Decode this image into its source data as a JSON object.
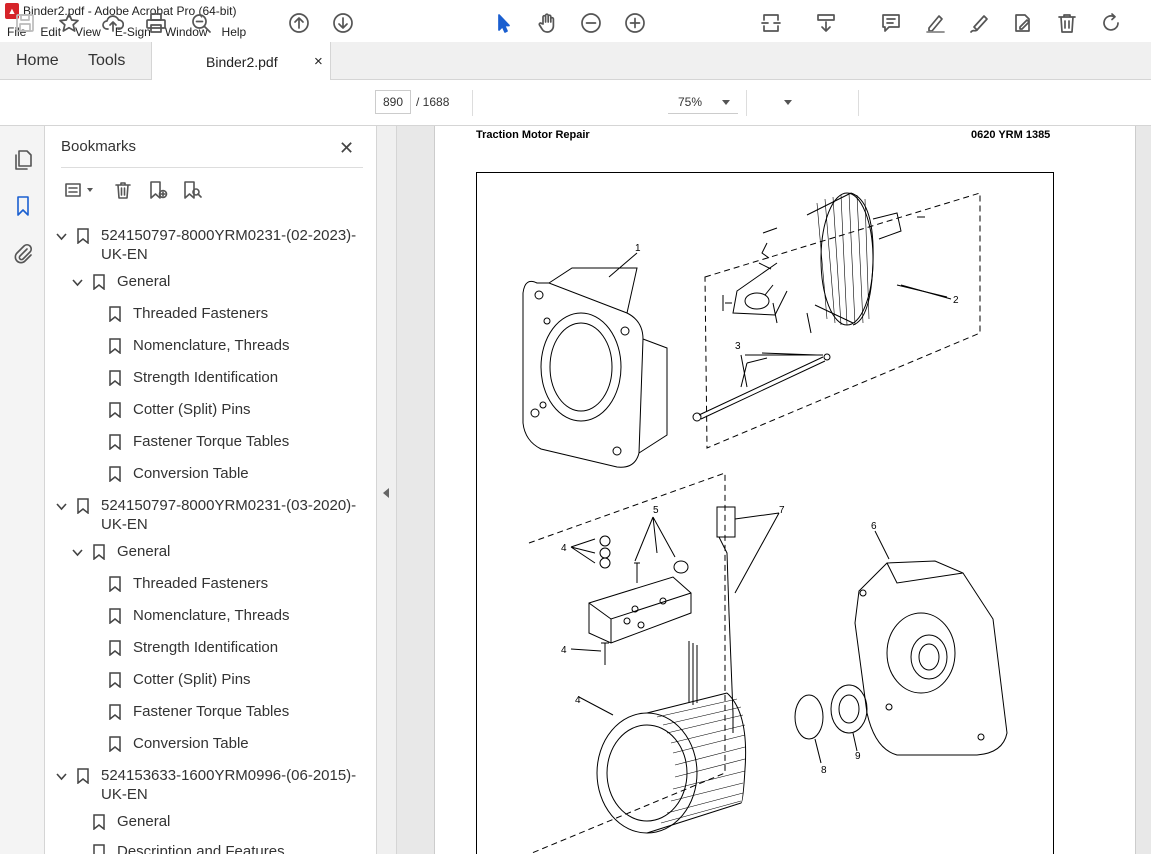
{
  "window": {
    "title": "Binder2.pdf - Adobe Acrobat Pro (64-bit)"
  },
  "menu": [
    "File",
    "Edit",
    "View",
    "E-Sign",
    "Window",
    "Help"
  ],
  "tabs": {
    "home": "Home",
    "tools": "Tools",
    "document": "Binder2.pdf",
    "close": "×"
  },
  "toolbar": {
    "current_page": "890",
    "page_total": "/  1688",
    "zoom": "75%"
  },
  "sidebar": {
    "title": "Bookmarks",
    "close": "✕",
    "items": [
      {
        "label": "524150797-8000YRM0231-(02-2023)-",
        "label2": "UK-EN",
        "level": 0,
        "expanded": true
      },
      {
        "label": "General",
        "level": 1,
        "expanded": true
      },
      {
        "label": "Threaded Fasteners",
        "level": 2
      },
      {
        "label": "Nomenclature, Threads",
        "level": 2
      },
      {
        "label": "Strength Identification",
        "level": 2
      },
      {
        "label": "Cotter (Split) Pins",
        "level": 2
      },
      {
        "label": "Fastener Torque Tables",
        "level": 2
      },
      {
        "label": "Conversion Table",
        "level": 2
      },
      {
        "label": "524150797-8000YRM0231-(03-2020)-",
        "label2": "UK-EN",
        "level": 0,
        "expanded": true
      },
      {
        "label": "General",
        "level": 1,
        "expanded": true
      },
      {
        "label": "Threaded Fasteners",
        "level": 2
      },
      {
        "label": "Nomenclature, Threads",
        "level": 2
      },
      {
        "label": "Strength Identification",
        "level": 2
      },
      {
        "label": "Cotter (Split) Pins",
        "level": 2
      },
      {
        "label": "Fastener Torque Tables",
        "level": 2
      },
      {
        "label": "Conversion Table",
        "level": 2
      },
      {
        "label": "524153633-1600YRM0996-(06-2015)-",
        "label2": "UK-EN",
        "level": 0,
        "expanded": true
      },
      {
        "label": "General",
        "level": 1
      },
      {
        "label": "Description and Features",
        "level": 1
      }
    ]
  },
  "document": {
    "header_left": "Traction Motor Repair",
    "header_right": "0620 YRM 1385",
    "callouts": [
      "1",
      "2",
      "3",
      "4",
      "4",
      "4",
      "5",
      "6",
      "7",
      "8",
      "9"
    ]
  }
}
